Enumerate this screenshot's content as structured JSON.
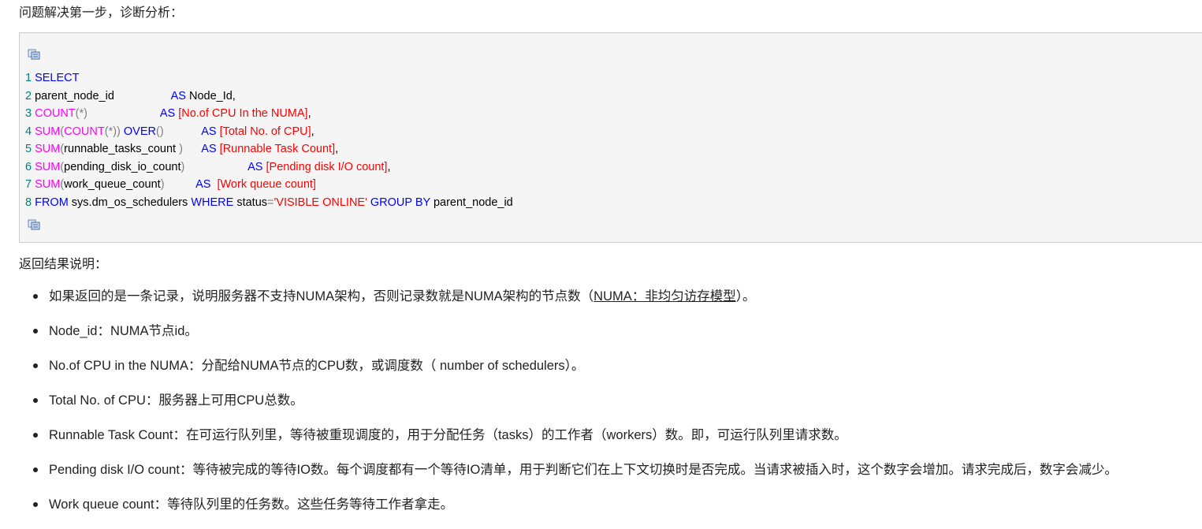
{
  "intro": "问题解决第一步，诊断分析：",
  "code": {
    "copy_icon": "copy-icon",
    "lines": [
      {
        "n": "1",
        "parts": [
          {
            "t": "SELECT",
            "c": "kw"
          }
        ]
      },
      {
        "n": "2",
        "parts": [
          {
            "t": "parent_node_id                  ",
            "c": ""
          },
          {
            "t": "AS",
            "c": "kw"
          },
          {
            "t": " Node_Id,",
            "c": ""
          }
        ]
      },
      {
        "n": "3",
        "parts": [
          {
            "t": "COUNT",
            "c": "fn"
          },
          {
            "t": "(*)",
            "c": "op"
          },
          {
            "t": "                       ",
            "c": ""
          },
          {
            "t": "AS",
            "c": "kw"
          },
          {
            "t": " ",
            "c": ""
          },
          {
            "t": "[No.of CPU In the NUMA]",
            "c": "str"
          },
          {
            "t": ",",
            "c": ""
          }
        ]
      },
      {
        "n": "4",
        "parts": [
          {
            "t": "SUM",
            "c": "fn"
          },
          {
            "t": "(",
            "c": "op"
          },
          {
            "t": "COUNT",
            "c": "fn"
          },
          {
            "t": "(*)) ",
            "c": "op"
          },
          {
            "t": "OVER",
            "c": "kw"
          },
          {
            "t": "()",
            "c": "op"
          },
          {
            "t": "            ",
            "c": ""
          },
          {
            "t": "AS",
            "c": "kw"
          },
          {
            "t": " ",
            "c": ""
          },
          {
            "t": "[Total No. of CPU]",
            "c": "str"
          },
          {
            "t": ",",
            "c": ""
          }
        ]
      },
      {
        "n": "5",
        "parts": [
          {
            "t": "SUM",
            "c": "fn"
          },
          {
            "t": "(",
            "c": "op"
          },
          {
            "t": "runnable_tasks_count ",
            "c": ""
          },
          {
            "t": ")",
            "c": "op"
          },
          {
            "t": "      ",
            "c": ""
          },
          {
            "t": "AS",
            "c": "kw"
          },
          {
            "t": " ",
            "c": ""
          },
          {
            "t": "[Runnable Task Count]",
            "c": "str"
          },
          {
            "t": ",",
            "c": ""
          }
        ]
      },
      {
        "n": "6",
        "parts": [
          {
            "t": "SUM",
            "c": "fn"
          },
          {
            "t": "(",
            "c": "op"
          },
          {
            "t": "pending_disk_io_count",
            "c": ""
          },
          {
            "t": ")",
            "c": "op"
          },
          {
            "t": "                    ",
            "c": ""
          },
          {
            "t": "AS",
            "c": "kw"
          },
          {
            "t": " ",
            "c": ""
          },
          {
            "t": "[Pending disk I/O count]",
            "c": "str"
          },
          {
            "t": ",",
            "c": ""
          }
        ]
      },
      {
        "n": "7",
        "parts": [
          {
            "t": "SUM",
            "c": "fn"
          },
          {
            "t": "(",
            "c": "op"
          },
          {
            "t": "work_queue_count",
            "c": ""
          },
          {
            "t": ")",
            "c": "op"
          },
          {
            "t": "          ",
            "c": ""
          },
          {
            "t": "AS",
            "c": "kw"
          },
          {
            "t": "  ",
            "c": ""
          },
          {
            "t": "[Work queue count]",
            "c": "str"
          }
        ]
      },
      {
        "n": "8",
        "parts": [
          {
            "t": "FROM",
            "c": "kw"
          },
          {
            "t": " sys.dm_os_schedulers ",
            "c": ""
          },
          {
            "t": "WHERE",
            "c": "kw"
          },
          {
            "t": " status",
            "c": ""
          },
          {
            "t": "=",
            "c": "op"
          },
          {
            "t": "'VISIBLE ONLINE'",
            "c": "str"
          },
          {
            "t": " ",
            "c": ""
          },
          {
            "t": "GROUP",
            "c": "kw"
          },
          {
            "t": " ",
            "c": ""
          },
          {
            "t": "BY",
            "c": "kw"
          },
          {
            "t": " parent_node_id",
            "c": ""
          }
        ]
      }
    ]
  },
  "results_title": "返回结果说明：",
  "bullets": [
    {
      "text": "如果返回的是一条记录，说明服务器不支持NUMA架构，否则记录数就是NUMA架构的节点数（",
      "link": "NUMA：非均匀访存模型",
      "tail": "）。"
    },
    {
      "text": "Node_id：NUMA节点id。"
    },
    {
      "text": "No.of CPU in the NUMA：分配给NUMA节点的CPU数，或调度数（ number of schedulers）。"
    },
    {
      "text": "Total No. of CPU：服务器上可用CPU总数。"
    },
    {
      "text": "Runnable Task Count：在可运行队列里，等待被重现调度的，用于分配任务（tasks）的工作者（workers）数。即，可运行队列里请求数。"
    },
    {
      "text": "Pending disk I/O count：等待被完成的等待IO数。每个调度都有一个等待IO清单，用于判断它们在上下文切换时是否完成。当请求被插入时，这个数字会增加。请求完成后，数字会减少。"
    },
    {
      "text": "Work queue count：等待队列里的任务数。这些任务等待工作者拿走。"
    }
  ]
}
